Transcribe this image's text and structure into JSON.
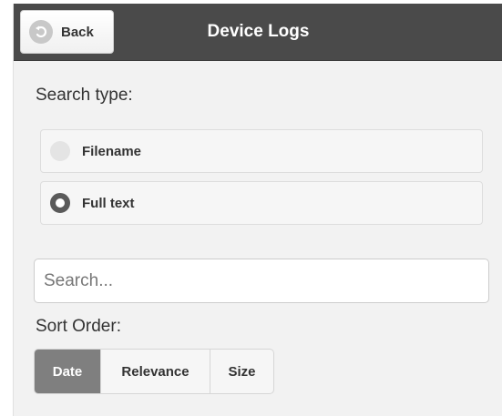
{
  "header": {
    "title": "Device Logs",
    "back_label": "Back",
    "back_icon": "back-arrow-circle-icon"
  },
  "search_type": {
    "label": "Search type:",
    "options": [
      {
        "label": "Filename",
        "selected": false
      },
      {
        "label": "Full text",
        "selected": true
      }
    ]
  },
  "search": {
    "placeholder": "Search...",
    "value": ""
  },
  "sort_order": {
    "label": "Sort Order:",
    "options": [
      {
        "label": "Date",
        "active": true
      },
      {
        "label": "Relevance",
        "active": false
      },
      {
        "label": "Size",
        "active": false
      }
    ]
  },
  "colors": {
    "header_bg": "#4a4a4a",
    "active_segment": "#7f7f7f",
    "page_bg": "#f2f2f2"
  }
}
